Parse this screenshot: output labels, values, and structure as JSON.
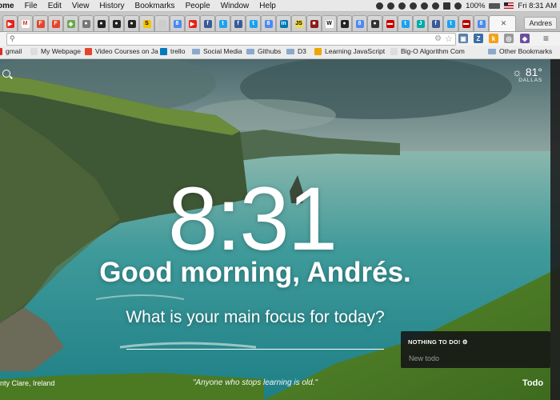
{
  "menubar": {
    "app": "ome",
    "items": [
      "File",
      "Edit",
      "View",
      "History",
      "Bookmarks",
      "People",
      "Window",
      "Help"
    ],
    "battery": "100%",
    "clock": "Fri 8:31 AM"
  },
  "tabs": {
    "profile": "Andres"
  },
  "toolbar": {
    "omnibox_value": ""
  },
  "bookmarks": [
    {
      "label": "gmail",
      "color": "#d93025"
    },
    {
      "label": "My Webpage",
      "color": "#ffffff"
    },
    {
      "label": "Video Courses on Ja",
      "color": "#e5452b"
    },
    {
      "label": "trello",
      "color": "#0079bf"
    },
    {
      "label": "Social Media",
      "color": "folder"
    },
    {
      "label": "Githubs",
      "color": "folder"
    },
    {
      "label": "D3",
      "color": "folder"
    },
    {
      "label": "Learning JavaScript",
      "color": "#f0a500"
    },
    {
      "label": "Big-O Algorithm Com",
      "color": "#ffffff"
    },
    {
      "label": "Other Bookmarks",
      "color": "folder"
    }
  ],
  "weather": {
    "temp": "81°",
    "city": "DALLAS"
  },
  "clock": "8:31",
  "greeting": "Good morning, Andrés.",
  "focus_question": "What is your main focus for today?",
  "location": "nty Clare, Ireland",
  "quote": "\"Anyone who stops learning is old.\"",
  "todo": {
    "header": "NOTHING TO DO!",
    "placeholder": "New todo",
    "button": "Todo"
  }
}
